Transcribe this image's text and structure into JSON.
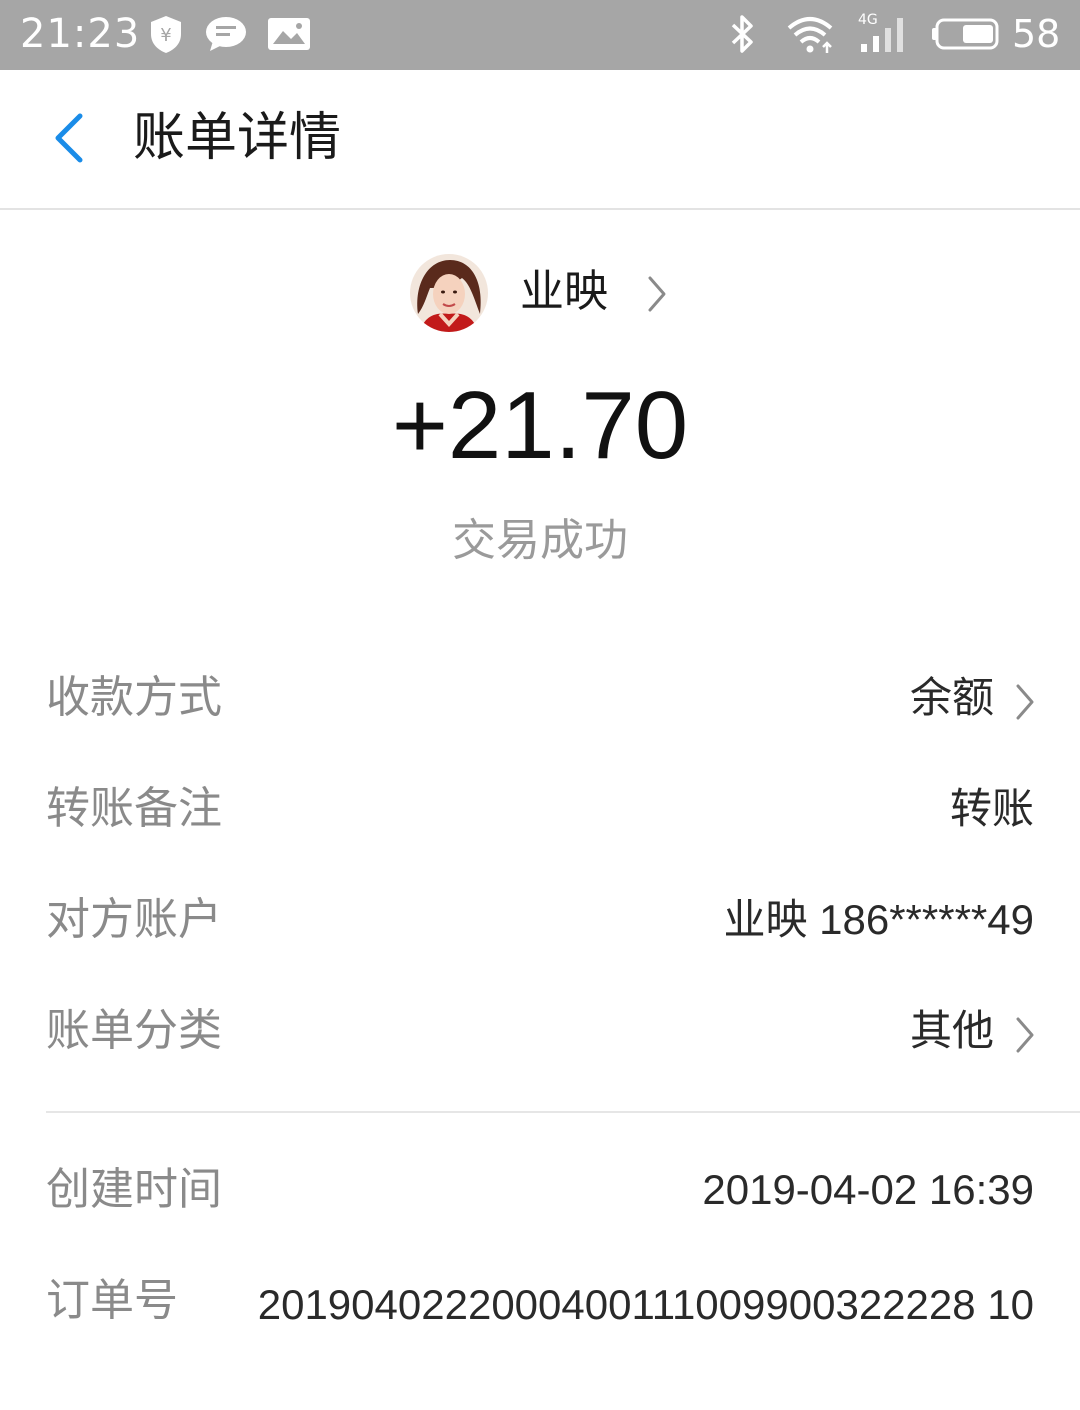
{
  "status_bar": {
    "time": "21:23",
    "battery_level": "58",
    "icons": [
      "shield-yen-icon",
      "message-icon",
      "image-notification-icon",
      "bluetooth-icon",
      "wifi-icon",
      "4g-signal-icon",
      "battery-icon"
    ],
    "network_label": "4G"
  },
  "header": {
    "back_icon": "chevron-left-icon",
    "title": "账单详情",
    "accent_color": "#1a8ce8"
  },
  "summary": {
    "payer_name": "业映",
    "amount": "+21.70",
    "status": "交易成功"
  },
  "details": [
    {
      "label": "收款方式",
      "value": "余额",
      "chevron": true
    },
    {
      "label": "转账备注",
      "value": "转账",
      "chevron": false
    },
    {
      "label": "对方账户",
      "value": "业映 186******49",
      "chevron": false
    },
    {
      "label": "账单分类",
      "value": "其他",
      "chevron": true
    },
    {
      "label": "创建时间",
      "value": "2019-04-02 16:39",
      "chevron": false
    },
    {
      "label": "订单号",
      "value": "2019040222000400111009900322228 10",
      "chevron": false
    }
  ]
}
